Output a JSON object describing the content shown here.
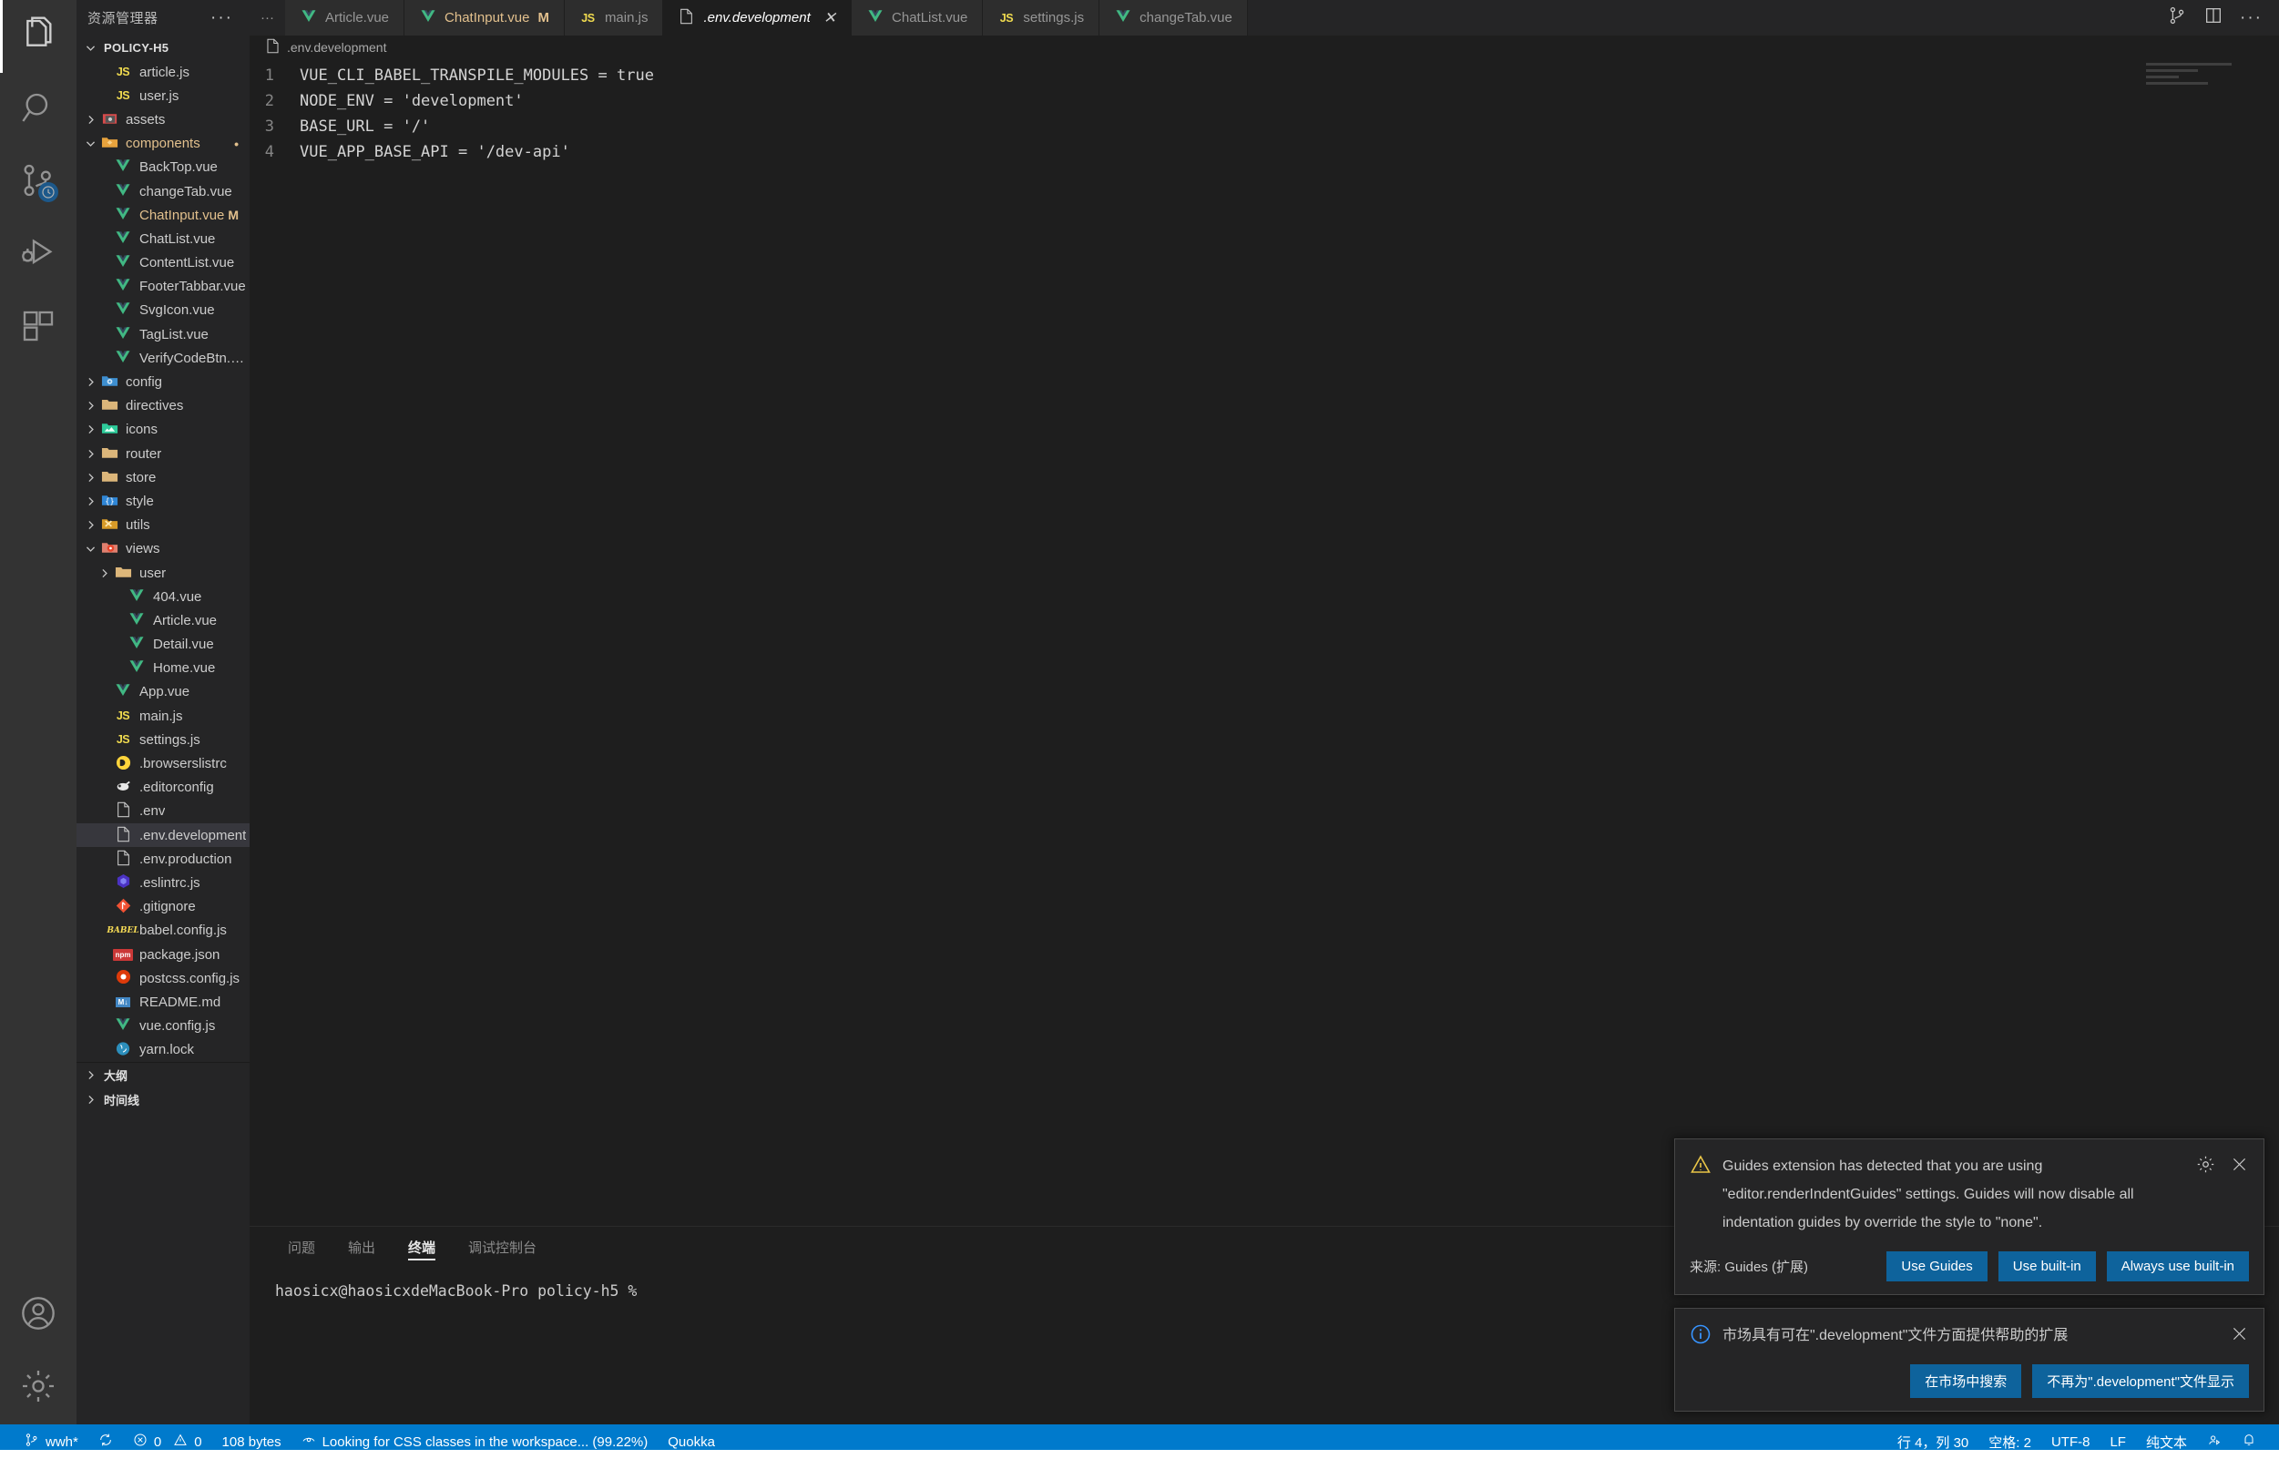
{
  "window": {
    "background": "#1e1e1e",
    "accent": "#007acc"
  },
  "activitybar": {
    "items": [
      {
        "name": "explorer",
        "icon": "files-icon",
        "active": true
      },
      {
        "name": "search",
        "icon": "search-icon",
        "active": false
      },
      {
        "name": "source-control",
        "icon": "source-control-icon",
        "active": false,
        "badge": "clock-badge"
      },
      {
        "name": "run-debug",
        "icon": "run-debug-icon",
        "active": false
      },
      {
        "name": "extensions",
        "icon": "extensions-icon",
        "active": false
      }
    ],
    "bottom": [
      {
        "name": "accounts",
        "icon": "account-icon"
      },
      {
        "name": "manage",
        "icon": "gear-icon"
      }
    ]
  },
  "sidebar": {
    "title": "资源管理器",
    "more_actions": "···",
    "root": {
      "label": "POLICY-H5",
      "expanded": true
    },
    "tree": [
      {
        "label": "article.js",
        "icon": "js",
        "indent": 2,
        "twisty": "none"
      },
      {
        "label": "user.js",
        "icon": "js",
        "indent": 2,
        "twisty": "none"
      },
      {
        "label": "assets",
        "icon": "folder-assets",
        "indent": 1,
        "twisty": "collapsed"
      },
      {
        "label": "components",
        "icon": "folder-components",
        "indent": 1,
        "twisty": "expanded",
        "modified": true,
        "mark": "•"
      },
      {
        "label": "BackTop.vue",
        "icon": "vue",
        "indent": 2,
        "twisty": "none"
      },
      {
        "label": "changeTab.vue",
        "icon": "vue",
        "indent": 2,
        "twisty": "none"
      },
      {
        "label": "ChatInput.vue",
        "icon": "vue",
        "indent": 2,
        "twisty": "none",
        "modified": true,
        "mark": "M"
      },
      {
        "label": "ChatList.vue",
        "icon": "vue",
        "indent": 2,
        "twisty": "none"
      },
      {
        "label": "ContentList.vue",
        "icon": "vue",
        "indent": 2,
        "twisty": "none"
      },
      {
        "label": "FooterTabbar.vue",
        "icon": "vue",
        "indent": 2,
        "twisty": "none"
      },
      {
        "label": "SvgIcon.vue",
        "icon": "vue",
        "indent": 2,
        "twisty": "none"
      },
      {
        "label": "TagList.vue",
        "icon": "vue",
        "indent": 2,
        "twisty": "none"
      },
      {
        "label": "VerifyCodeBtn.vue",
        "icon": "vue",
        "indent": 2,
        "twisty": "none"
      },
      {
        "label": "config",
        "icon": "folder-config",
        "indent": 1,
        "twisty": "collapsed"
      },
      {
        "label": "directives",
        "icon": "folder",
        "indent": 1,
        "twisty": "collapsed"
      },
      {
        "label": "icons",
        "icon": "folder-icons",
        "indent": 1,
        "twisty": "collapsed"
      },
      {
        "label": "router",
        "icon": "folder",
        "indent": 1,
        "twisty": "collapsed"
      },
      {
        "label": "store",
        "icon": "folder",
        "indent": 1,
        "twisty": "collapsed"
      },
      {
        "label": "style",
        "icon": "folder-style",
        "indent": 1,
        "twisty": "collapsed"
      },
      {
        "label": "utils",
        "icon": "folder-utils",
        "indent": 1,
        "twisty": "collapsed"
      },
      {
        "label": "views",
        "icon": "folder-views",
        "indent": 1,
        "twisty": "expanded"
      },
      {
        "label": "user",
        "icon": "folder",
        "indent": 2,
        "twisty": "collapsed"
      },
      {
        "label": "404.vue",
        "icon": "vue",
        "indent": 3,
        "twisty": "none"
      },
      {
        "label": "Article.vue",
        "icon": "vue",
        "indent": 3,
        "twisty": "none"
      },
      {
        "label": "Detail.vue",
        "icon": "vue",
        "indent": 3,
        "twisty": "none"
      },
      {
        "label": "Home.vue",
        "icon": "vue",
        "indent": 3,
        "twisty": "none"
      },
      {
        "label": "App.vue",
        "icon": "vue",
        "indent": 2,
        "twisty": "none"
      },
      {
        "label": "main.js",
        "icon": "js",
        "indent": 2,
        "twisty": "none"
      },
      {
        "label": "settings.js",
        "icon": "js",
        "indent": 2,
        "twisty": "none"
      },
      {
        "label": ".browserslistrc",
        "icon": "browserslist",
        "indent": 2,
        "twisty": "none"
      },
      {
        "label": ".editorconfig",
        "icon": "editorconfig",
        "indent": 2,
        "twisty": "none"
      },
      {
        "label": ".env",
        "icon": "file",
        "indent": 2,
        "twisty": "none"
      },
      {
        "label": ".env.development",
        "icon": "file",
        "indent": 2,
        "twisty": "none",
        "selected": true
      },
      {
        "label": ".env.production",
        "icon": "file",
        "indent": 2,
        "twisty": "none"
      },
      {
        "label": ".eslintrc.js",
        "icon": "eslint",
        "indent": 2,
        "twisty": "none"
      },
      {
        "label": ".gitignore",
        "icon": "git",
        "indent": 2,
        "twisty": "none"
      },
      {
        "label": "babel.config.js",
        "icon": "babel",
        "indent": 2,
        "twisty": "none"
      },
      {
        "label": "package.json",
        "icon": "npm",
        "indent": 2,
        "twisty": "none"
      },
      {
        "label": "postcss.config.js",
        "icon": "postcss",
        "indent": 2,
        "twisty": "none"
      },
      {
        "label": "README.md",
        "icon": "md",
        "indent": 2,
        "twisty": "none"
      },
      {
        "label": "vue.config.js",
        "icon": "vue",
        "indent": 2,
        "twisty": "none"
      },
      {
        "label": "yarn.lock",
        "icon": "yarn",
        "indent": 2,
        "twisty": "none"
      }
    ],
    "sections": [
      {
        "label": "大纲"
      },
      {
        "label": "时间线"
      }
    ]
  },
  "tabs": {
    "overflow_indicator": "···",
    "items": [
      {
        "label": "Article.vue",
        "icon": "vue",
        "active": false,
        "dirty": ""
      },
      {
        "label": "ChatInput.vue",
        "icon": "vue",
        "active": false,
        "dirty": "M",
        "modified": true
      },
      {
        "label": "main.js",
        "icon": "js",
        "active": false,
        "dirty": ""
      },
      {
        "label": ".env.development",
        "icon": "file",
        "active": true,
        "dirty": "",
        "close": "✕"
      },
      {
        "label": "ChatList.vue",
        "icon": "vue",
        "active": false,
        "dirty": ""
      },
      {
        "label": "settings.js",
        "icon": "js",
        "active": false,
        "dirty": ""
      },
      {
        "label": "changeTab.vue",
        "icon": "vue",
        "active": false,
        "dirty": ""
      }
    ],
    "actions": [
      {
        "name": "split-editor-icon"
      },
      {
        "name": "open-changes-icon"
      },
      {
        "name": "more-actions-icon",
        "glyph": "···"
      }
    ]
  },
  "breadcrumb": {
    "path": ".env.development"
  },
  "editor": {
    "filename": ".env.development",
    "lines": [
      {
        "num": "1",
        "text": "VUE_CLI_BABEL_TRANSPILE_MODULES = true"
      },
      {
        "num": "2",
        "text": "NODE_ENV = 'development'"
      },
      {
        "num": "3",
        "text": "BASE_URL = '/'"
      },
      {
        "num": "4",
        "text": "VUE_APP_BASE_API = '/dev-api'"
      }
    ]
  },
  "panel": {
    "tabs": [
      {
        "label": "问题",
        "active": false
      },
      {
        "label": "输出",
        "active": false
      },
      {
        "label": "终端",
        "active": true
      },
      {
        "label": "调试控制台",
        "active": false
      }
    ],
    "terminal_line": "haosicx@haosicxdeMacBook-Pro policy-h5 %"
  },
  "notifications": [
    {
      "name": "guides-extension-notification",
      "icon": "warning-icon",
      "message": "Guides extension has detected that you are using \"editor.renderIndentGuides\" settings. Guides will now disable all indentation guides by override the style to \"none\".",
      "source": "来源: Guides (扩展)",
      "buttons": [
        "Use Guides",
        "Use built-in",
        "Always use built-in"
      ],
      "tools": [
        "gear-icon",
        "close-icon"
      ]
    },
    {
      "name": "marketplace-notification",
      "icon": "info-icon",
      "message": "市场具有可在\".development\"文件方面提供帮助的扩展",
      "source": "",
      "buttons": [
        "在市场中搜索",
        "不再为\".development\"文件显示"
      ],
      "tools": [
        "close-icon"
      ]
    }
  ],
  "statusbar": {
    "left": [
      {
        "name": "branch",
        "icon": "source-control-icon",
        "text": "wwh*"
      },
      {
        "name": "sync",
        "icon": "sync-icon",
        "text": ""
      },
      {
        "name": "problems",
        "icon": "error-warning-icon",
        "text": "0  0",
        "errors": "0",
        "warnings": "0"
      },
      {
        "name": "file-size",
        "icon": "",
        "text": "108 bytes"
      },
      {
        "name": "css-scan",
        "icon": "eye-icon",
        "text": "Looking for CSS classes in the workspace... (99.22%)"
      },
      {
        "name": "quokka",
        "icon": "",
        "text": "Quokka"
      }
    ],
    "right": [
      {
        "name": "cursor-position",
        "text": "行 4，列 30"
      },
      {
        "name": "indentation",
        "text": "空格: 2"
      },
      {
        "name": "encoding",
        "text": "UTF-8"
      },
      {
        "name": "eol",
        "text": "LF"
      },
      {
        "name": "language-mode",
        "text": "纯文本"
      },
      {
        "name": "live-share",
        "icon": "live-share-icon",
        "text": ""
      },
      {
        "name": "notifications-bell",
        "icon": "bell-icon",
        "text": ""
      }
    ]
  }
}
